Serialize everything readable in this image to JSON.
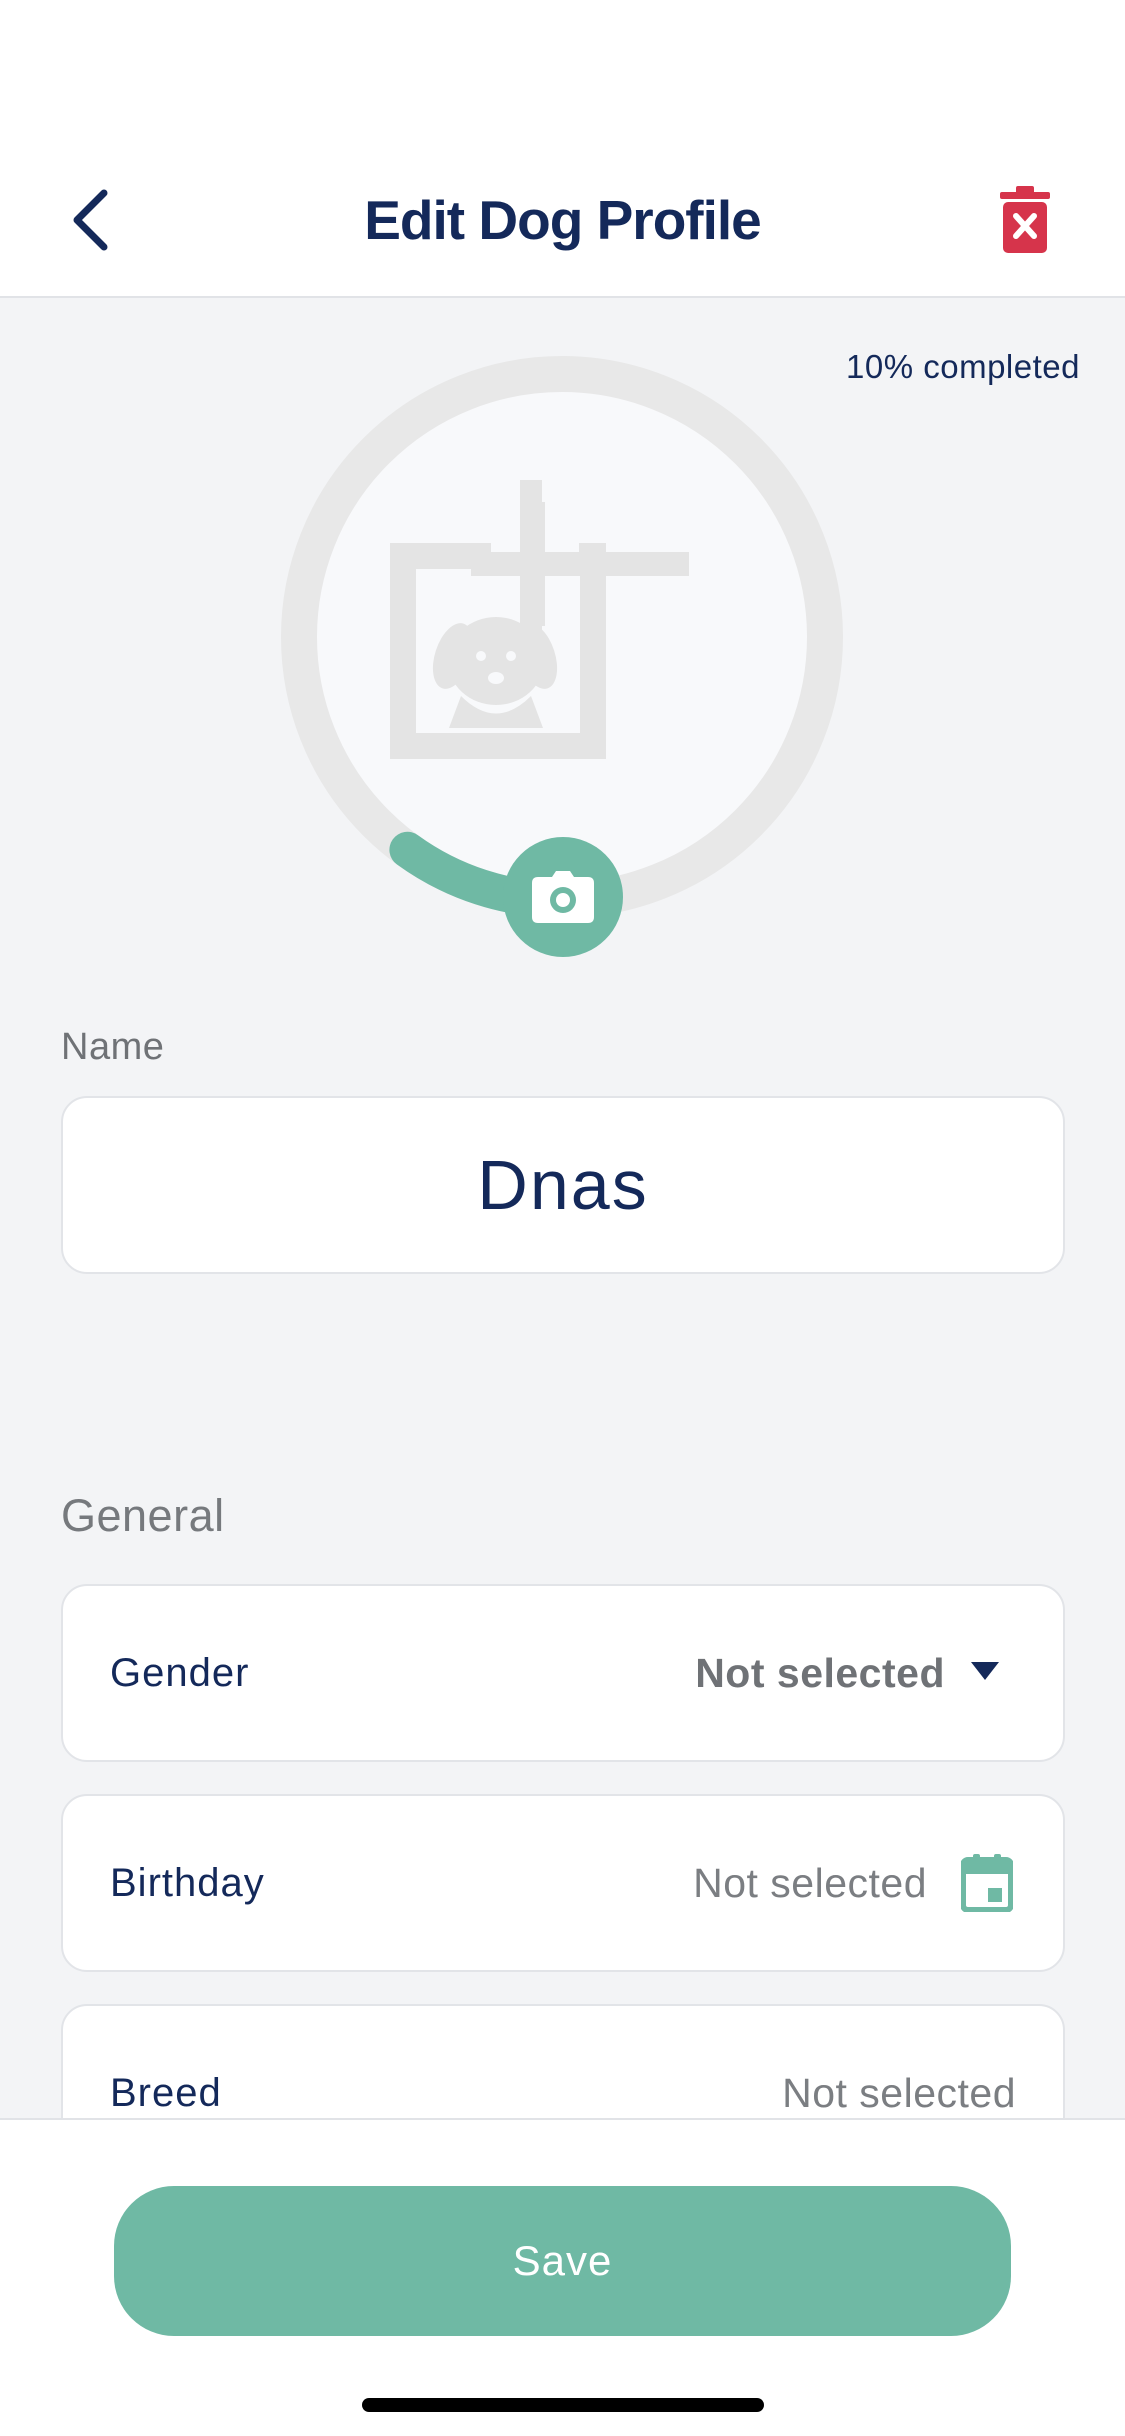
{
  "header": {
    "title": "Edit Dog Profile",
    "back_icon": "chevron-left-icon",
    "delete_icon": "trash-icon",
    "delete_color": "#d6344b"
  },
  "profile": {
    "completion_text": "10% completed",
    "completion_fraction": 0.1,
    "photo_placeholder_icon": "dog-photo-add-icon",
    "camera_icon": "camera-icon"
  },
  "name": {
    "label": "Name",
    "value": "Dnas"
  },
  "general": {
    "title": "General",
    "fields": [
      {
        "label": "Gender",
        "value": "Not selected",
        "control": "dropdown"
      },
      {
        "label": "Birthday",
        "value": "Not selected",
        "control": "date-picker"
      },
      {
        "label": "Breed",
        "value": "Not selected",
        "control": "picker"
      }
    ]
  },
  "footer": {
    "save_label": "Save"
  },
  "colors": {
    "accent": "#6fb9a4",
    "text_primary": "#14295a",
    "danger": "#d6344b"
  }
}
